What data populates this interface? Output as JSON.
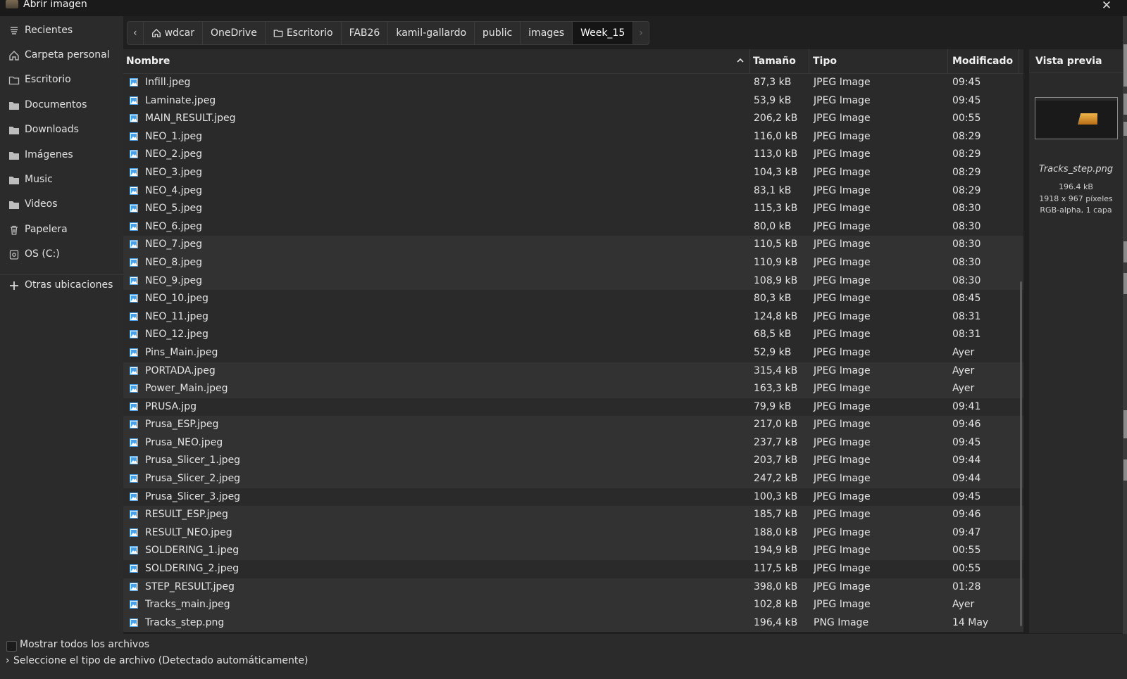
{
  "window": {
    "title": "Abrir imagen",
    "close_glyph": "✕"
  },
  "sidebar": {
    "items": [
      {
        "label": "Recientes",
        "icon": "recent-icon"
      },
      {
        "label": "Carpeta personal",
        "icon": "home-icon"
      },
      {
        "label": "Escritorio",
        "icon": "folder-outline-icon"
      },
      {
        "label": "Documentos",
        "icon": "folder-icon"
      },
      {
        "label": "Downloads",
        "icon": "folder-icon"
      },
      {
        "label": "Imágenes",
        "icon": "folder-icon"
      },
      {
        "label": "Music",
        "icon": "folder-icon"
      },
      {
        "label": "Videos",
        "icon": "folder-icon"
      },
      {
        "label": "Papelera",
        "icon": "trash-icon"
      },
      {
        "label": "OS (C:)",
        "icon": "drive-icon"
      },
      {
        "label": "Otras ubicaciones",
        "icon": "plus-icon"
      }
    ]
  },
  "pathbar": {
    "back": "‹",
    "forward": "›",
    "crumbs": [
      {
        "label": "wdcar",
        "icon": "home-icon"
      },
      {
        "label": "OneDrive"
      },
      {
        "label": "Escritorio",
        "icon": "folder-outline-icon"
      },
      {
        "label": "FAB26"
      },
      {
        "label": "kamil-gallardo"
      },
      {
        "label": "public"
      },
      {
        "label": "images"
      },
      {
        "label": "Week_15",
        "active": true
      }
    ]
  },
  "columns": {
    "name": "Nombre",
    "size": "Tamaño",
    "type": "Tipo",
    "modified": "Modificado"
  },
  "files": [
    {
      "name": "Infill.jpeg",
      "size": "87,3 kB",
      "type": "JPEG Image",
      "modified": "09:45",
      "shade": 1
    },
    {
      "name": "Laminate.jpeg",
      "size": "53,9 kB",
      "type": "JPEG Image",
      "modified": "09:45",
      "shade": 1
    },
    {
      "name": "MAIN_RESULT.jpeg",
      "size": "206,2 kB",
      "type": "JPEG Image",
      "modified": "00:55",
      "shade": 1
    },
    {
      "name": "NEO_1.jpeg",
      "size": "116,0 kB",
      "type": "JPEG Image",
      "modified": "08:29",
      "shade": 1
    },
    {
      "name": "NEO_2.jpeg",
      "size": "113,0 kB",
      "type": "JPEG Image",
      "modified": "08:29",
      "shade": 1
    },
    {
      "name": "NEO_3.jpeg",
      "size": "104,3 kB",
      "type": "JPEG Image",
      "modified": "08:29",
      "shade": 1
    },
    {
      "name": "NEO_4.jpeg",
      "size": "83,1 kB",
      "type": "JPEG Image",
      "modified": "08:29",
      "shade": 1
    },
    {
      "name": "NEO_5.jpeg",
      "size": "115,3 kB",
      "type": "JPEG Image",
      "modified": "08:30",
      "shade": 1
    },
    {
      "name": "NEO_6.jpeg",
      "size": "80,0 kB",
      "type": "JPEG Image",
      "modified": "08:30",
      "shade": 1
    },
    {
      "name": "NEO_7.jpeg",
      "size": "110,5 kB",
      "type": "JPEG Image",
      "modified": "08:30",
      "shade": 2
    },
    {
      "name": "NEO_8.jpeg",
      "size": "110,9 kB",
      "type": "JPEG Image",
      "modified": "08:30",
      "shade": 2
    },
    {
      "name": "NEO_9.jpeg",
      "size": "108,9 kB",
      "type": "JPEG Image",
      "modified": "08:30",
      "shade": 2
    },
    {
      "name": "NEO_10.jpeg",
      "size": "80,3 kB",
      "type": "JPEG Image",
      "modified": "08:45",
      "shade": 1
    },
    {
      "name": "NEO_11.jpeg",
      "size": "124,8 kB",
      "type": "JPEG Image",
      "modified": "08:31",
      "shade": 1
    },
    {
      "name": "NEO_12.jpeg",
      "size": "68,5 kB",
      "type": "JPEG Image",
      "modified": "08:31",
      "shade": 1
    },
    {
      "name": "Pins_Main.jpeg",
      "size": "52,9 kB",
      "type": "JPEG Image",
      "modified": "Ayer",
      "shade": 1
    },
    {
      "name": "PORTADA.jpeg",
      "size": "315,4 kB",
      "type": "JPEG Image",
      "modified": "Ayer",
      "shade": 2
    },
    {
      "name": "Power_Main.jpeg",
      "size": "163,3 kB",
      "type": "JPEG Image",
      "modified": "Ayer",
      "shade": 2
    },
    {
      "name": "PRUSA.jpg",
      "size": "79,9 kB",
      "type": "JPEG Image",
      "modified": "09:41",
      "shade": 1
    },
    {
      "name": "Prusa_ESP.jpeg",
      "size": "217,0 kB",
      "type": "JPEG Image",
      "modified": "09:46",
      "shade": 2
    },
    {
      "name": "Prusa_NEO.jpeg",
      "size": "237,7 kB",
      "type": "JPEG Image",
      "modified": "09:45",
      "shade": 2
    },
    {
      "name": "Prusa_Slicer_1.jpeg",
      "size": "203,7 kB",
      "type": "JPEG Image",
      "modified": "09:44",
      "shade": 2
    },
    {
      "name": "Prusa_Slicer_2.jpeg",
      "size": "247,2 kB",
      "type": "JPEG Image",
      "modified": "09:44",
      "shade": 2
    },
    {
      "name": "Prusa_Slicer_3.jpeg",
      "size": "100,3 kB",
      "type": "JPEG Image",
      "modified": "09:45",
      "shade": 1
    },
    {
      "name": "RESULT_ESP.jpeg",
      "size": "185,7 kB",
      "type": "JPEG Image",
      "modified": "09:46",
      "shade": 2
    },
    {
      "name": "RESULT_NEO.jpeg",
      "size": "188,0 kB",
      "type": "JPEG Image",
      "modified": "09:47",
      "shade": 2
    },
    {
      "name": "SOLDERING_1.jpeg",
      "size": "194,9 kB",
      "type": "JPEG Image",
      "modified": "00:55",
      "shade": 2
    },
    {
      "name": "SOLDERING_2.jpeg",
      "size": "117,5 kB",
      "type": "JPEG Image",
      "modified": "00:55",
      "shade": 1
    },
    {
      "name": "STEP_RESULT.jpeg",
      "size": "398,0 kB",
      "type": "JPEG Image",
      "modified": "01:28",
      "shade": 2
    },
    {
      "name": "Tracks_main.jpeg",
      "size": "102,8 kB",
      "type": "JPEG Image",
      "modified": "Ayer",
      "shade": 2
    },
    {
      "name": "Tracks_step.png",
      "size": "196,4 kB",
      "type": "PNG Image",
      "modified": "14 May",
      "shade": 2
    }
  ],
  "preview": {
    "title": "Vista previa",
    "file_name": "Tracks_step.png",
    "size": "196.4 kB",
    "dimensions": "1918 x 967 píxeles",
    "mode": "RGB-alpha, 1 capa"
  },
  "bottom": {
    "show_all_label": "Mostrar todos los archivos",
    "show_all_checked": false,
    "filetype_label": "Seleccione el tipo de archivo (Detectado automáticamente)"
  },
  "colors": {
    "file_icon": "#4aa0e6",
    "active_crumb": "#151515",
    "row_shade_1": "#2a2a2a",
    "row_shade_2": "#323232"
  }
}
